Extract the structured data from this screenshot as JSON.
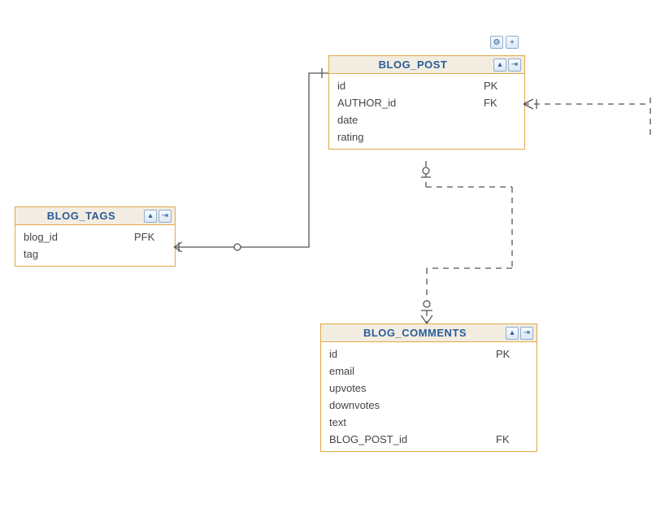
{
  "toolbar": {
    "gear": "⚙",
    "plus": "+",
    "collapse": "▴",
    "expand": "⇥"
  },
  "entities": {
    "blog_post": {
      "title": "BLOG_POST",
      "rows": [
        {
          "name": "id",
          "key": "PK"
        },
        {
          "name": "AUTHOR_id",
          "key": "FK"
        },
        {
          "name": "date",
          "key": ""
        },
        {
          "name": "rating",
          "key": ""
        }
      ]
    },
    "blog_tags": {
      "title": "BLOG_TAGS",
      "rows": [
        {
          "name": "blog_id",
          "key": "PFK"
        },
        {
          "name": "tag",
          "key": ""
        }
      ]
    },
    "blog_comments": {
      "title": "BLOG_COMMENTS",
      "rows": [
        {
          "name": "id",
          "key": "PK"
        },
        {
          "name": "email",
          "key": ""
        },
        {
          "name": "upvotes",
          "key": ""
        },
        {
          "name": "downvotes",
          "key": ""
        },
        {
          "name": "text",
          "key": ""
        },
        {
          "name": "BLOG_POST_id",
          "key": "FK"
        }
      ]
    }
  }
}
